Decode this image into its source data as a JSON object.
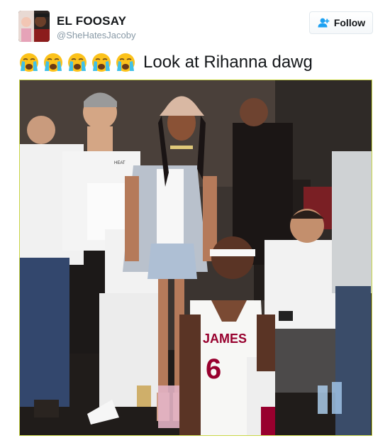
{
  "tweet": {
    "author_name": "EL FOOSAY",
    "author_handle": "@SheHatesJacoby",
    "follow_label": "Follow",
    "text": "Look at Rihanna dawg",
    "emoji": [
      "loudly-crying-face",
      "loudly-crying-face",
      "loudly-crying-face",
      "loudly-crying-face",
      "loudly-crying-face"
    ]
  },
  "photo": {
    "jersey_name": "JAMES",
    "jersey_number": "6",
    "shirt_logo": "HEAT"
  },
  "colors": {
    "follow_icon": "#1da1f2",
    "handle": "#8899a6",
    "text": "#14171a",
    "photo_border": "#c9d646",
    "jersey_red": "#98002e"
  }
}
